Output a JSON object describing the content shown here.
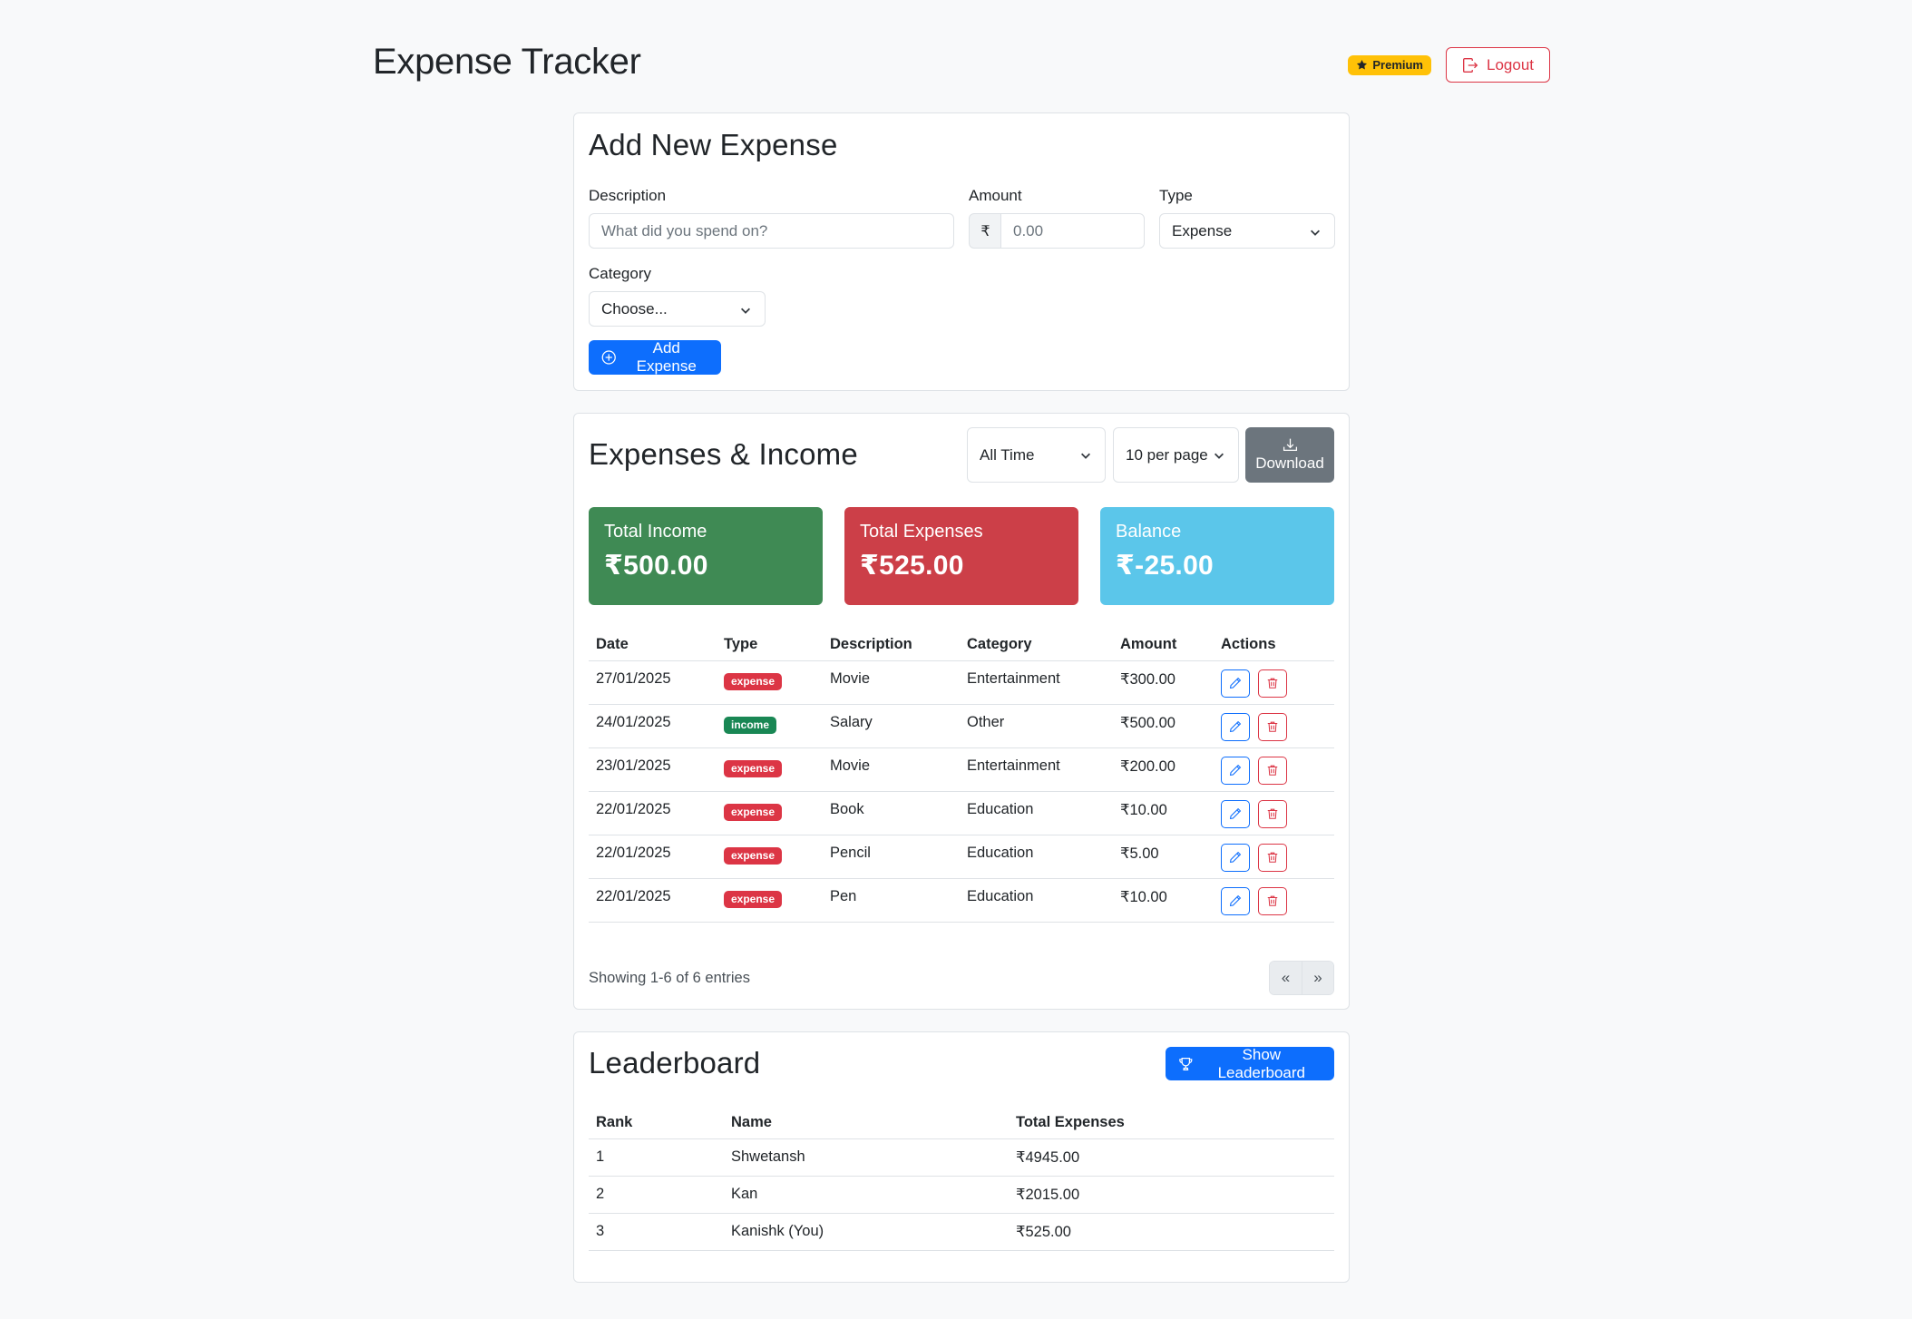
{
  "header": {
    "title": "Expense Tracker",
    "premium_label": "Premium",
    "logout_label": "Logout"
  },
  "add_form": {
    "title": "Add New Expense",
    "description_label": "Description",
    "description_placeholder": "What did you spend on?",
    "amount_label": "Amount",
    "currency_symbol": "₹",
    "amount_placeholder": "0.00",
    "type_label": "Type",
    "type_value": "Expense",
    "category_label": "Category",
    "category_value": "Choose...",
    "submit_label": "Add Expense"
  },
  "transactions": {
    "title": "Expenses & Income",
    "period_filter": "All Time",
    "page_size": "10 per page",
    "download_label": "Download",
    "summary": {
      "income_label": "Total Income",
      "income_value": "₹500.00",
      "expenses_label": "Total Expenses",
      "expenses_value": "₹525.00",
      "balance_label": "Balance",
      "balance_value": "₹-25.00"
    },
    "columns": [
      "Date",
      "Type",
      "Description",
      "Category",
      "Amount",
      "Actions"
    ],
    "rows": [
      {
        "date": "27/01/2025",
        "type": "expense",
        "description": "Movie",
        "category": "Entertainment",
        "amount": "₹300.00"
      },
      {
        "date": "24/01/2025",
        "type": "income",
        "description": "Salary",
        "category": "Other",
        "amount": "₹500.00"
      },
      {
        "date": "23/01/2025",
        "type": "expense",
        "description": "Movie",
        "category": "Entertainment",
        "amount": "₹200.00"
      },
      {
        "date": "22/01/2025",
        "type": "expense",
        "description": "Book",
        "category": "Education",
        "amount": "₹10.00"
      },
      {
        "date": "22/01/2025",
        "type": "expense",
        "description": "Pencil",
        "category": "Education",
        "amount": "₹5.00"
      },
      {
        "date": "22/01/2025",
        "type": "expense",
        "description": "Pen",
        "category": "Education",
        "amount": "₹10.00"
      }
    ],
    "showing_text": "Showing 1-6 of 6 entries",
    "prev_label": "«",
    "next_label": "»"
  },
  "leaderboard": {
    "title": "Leaderboard",
    "show_label": "Show Leaderboard",
    "columns": [
      "Rank",
      "Name",
      "Total Expenses"
    ],
    "rows": [
      {
        "rank": "1",
        "name": "Shwetansh",
        "total": "₹4945.00"
      },
      {
        "rank": "2",
        "name": "Kan",
        "total": "₹2015.00"
      },
      {
        "rank": "3",
        "name": "Kanishk (You)",
        "total": "₹525.00"
      }
    ]
  },
  "colors": {
    "primary": "#0d6efd",
    "income": "#3f8a54",
    "expense": "#cc3f48",
    "balance": "#5bc6ea",
    "premium": "#ffc107",
    "secondary": "#6c757d"
  }
}
